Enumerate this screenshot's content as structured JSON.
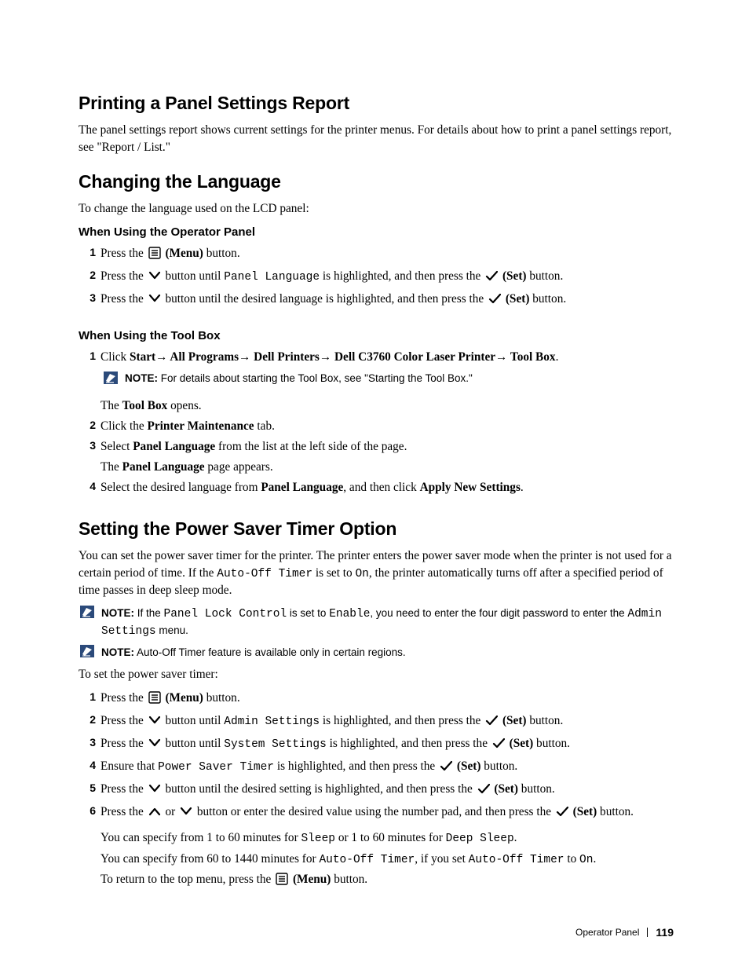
{
  "section1": {
    "title": "Printing a Panel Settings Report",
    "lead": "The panel settings report shows current settings for the printer menus. For details about how to print a panel settings report, see \"Report / List.\""
  },
  "section2": {
    "title": "Changing the Language",
    "lead": "To change the language used on the LCD panel:",
    "sub1": "When Using the Operator Panel",
    "steps1": {
      "s1a": "Press the ",
      "s1b": " (Menu)",
      "s1c": " button.",
      "s2a": "Press the ",
      "s2b": " button until ",
      "s2code": "Panel Language",
      "s2c": " is highlighted, and then press the ",
      "s2d": " (Set)",
      "s2e": " button.",
      "s3a": "Press the ",
      "s3b": " button until the desired language is highlighted, and then press the ",
      "s3c": " (Set)",
      "s3d": " button."
    },
    "sub2": "When Using the Tool Box",
    "steps2": {
      "s1a": "Click ",
      "s1b": "Start",
      "s1c": "→",
      "s1d": " All Programs",
      "s1e": "→",
      "s1f": " Dell Printers",
      "s1g": "→",
      "s1h": " Dell C3760 Color Laser Printer",
      "s1i": "→",
      "s1j": " Tool Box",
      "s1k": ".",
      "n1a": "NOTE:",
      "n1b": " For details about starting the Tool Box, see \"Starting the Tool Box.\"",
      "s1f2a": "The ",
      "s1f2b": "Tool Box",
      "s1f2c": " opens.",
      "s2a": "Click the ",
      "s2b": "Printer Maintenance",
      "s2c": " tab.",
      "s3a": "Select ",
      "s3b": "Panel Language",
      "s3c": " from the list at the left side of the page.",
      "s3f2a": "The ",
      "s3f2b": "Panel Language",
      "s3f2c": " page appears.",
      "s4a": "Select the desired language from ",
      "s4b": "Panel Language",
      "s4c": ", and then click ",
      "s4d": "Apply New Settings",
      "s4e": "."
    }
  },
  "section3": {
    "title": "Setting the Power Saver Timer Option",
    "leadA": "You can set the power saver timer for the printer. The printer enters the power saver mode when the printer is not used for a certain period of time. If the ",
    "leadCode1": "Auto-Off Timer",
    "leadB": " is set to ",
    "leadCode2": "On",
    "leadC": ", the printer automatically turns off after a specified period of time passes in deep sleep mode.",
    "note1": {
      "label": "NOTE:",
      "a": " If the ",
      "code1": "Panel Lock Control",
      "b": " is set to ",
      "code2": "Enable",
      "c": ", you need to enter the four digit password to enter the ",
      "code3": "Admin Settings",
      "d": " menu."
    },
    "note2": {
      "label": "NOTE:",
      "a": " Auto-Off Timer feature is available only in certain regions."
    },
    "intro": "To set the power saver timer:",
    "steps": {
      "s1a": "Press the ",
      "s1b": " (Menu)",
      "s1c": " button.",
      "s2a": "Press the ",
      "s2b": " button until ",
      "s2code": "Admin Settings",
      "s2c": " is highlighted, and then press the ",
      "s2d": " (Set)",
      "s2e": " button.",
      "s3a": "Press the ",
      "s3b": " button until ",
      "s3code": "System Settings",
      "s3c": " is highlighted, and then press the ",
      "s3d": " (Set)",
      "s3e": " button.",
      "s4a": "Ensure that ",
      "s4code": "Power Saver Timer",
      "s4b": " is highlighted, and then press the ",
      "s4c": " (Set)",
      "s4d": " button.",
      "s5a": "Press the ",
      "s5b": " button until the desired setting is highlighted, and then press the ",
      "s5c": " (Set)",
      "s5d": " button.",
      "s6a": "Press the ",
      "s6b": " or ",
      "s6c": " button or enter the desired value using the number pad, and then press the ",
      "s6d": " (Set)",
      "s6e": " button.",
      "f1a": "You can specify from 1 to 60 minutes for ",
      "f1code1": "Sleep",
      "f1b": " or 1 to 60 minutes for ",
      "f1code2": "Deep Sleep",
      "f1c": ".",
      "f2a": "You can specify from 60 to 1440 minutes for ",
      "f2code1": "Auto-Off Timer",
      "f2b": ", if you set ",
      "f2code2": "Auto-Off Timer",
      "f2c": " to ",
      "f2code3": "On",
      "f2d": ".",
      "f3a": "To return to the top menu, press the ",
      "f3b": " (Menu)",
      "f3c": " button."
    }
  },
  "footer": {
    "label": "Operator Panel",
    "page": "119"
  }
}
